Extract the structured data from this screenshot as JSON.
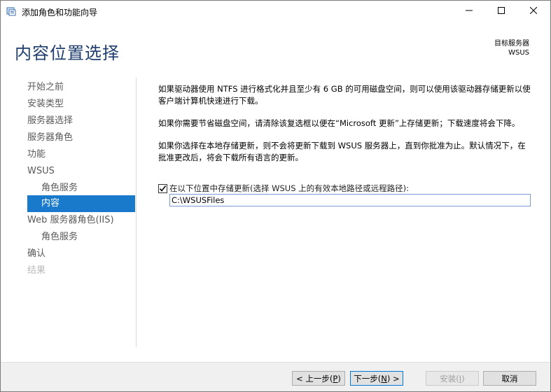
{
  "window": {
    "title": "添加角色和功能向导"
  },
  "header": {
    "page_title": "内容位置选择",
    "target_label": "目标服务器",
    "target_server": "WSUS"
  },
  "nav": {
    "items": [
      {
        "label": "开始之前"
      },
      {
        "label": "安装类型"
      },
      {
        "label": "服务器选择"
      },
      {
        "label": "服务器角色"
      },
      {
        "label": "功能"
      },
      {
        "label": "WSUS"
      },
      {
        "label": "角色服务"
      },
      {
        "label": "内容"
      },
      {
        "label": "Web 服务器角色(IIS)"
      },
      {
        "label": "角色服务"
      },
      {
        "label": "确认"
      },
      {
        "label": "结果"
      }
    ]
  },
  "content": {
    "para1": "如果驱动器使用 NTFS 进行格式化并且至少有 6 GB 的可用磁盘空间，则可以使用该驱动器存储更新以使客户端计算机快速进行下载。",
    "para2": "如果你需要节省磁盘空间，请清除该复选框以便在“Microsoft 更新”上存储更新；下载速度将会下降。",
    "para3": "如果你选择在本地存储更新，则不会将更新下载到 WSUS 服务器上，直到你批准为止。默认情况下，在批准更改后，将会下载所有语言的更新。",
    "checkbox_label": "在以下位置中存储更新(选择 WSUS 上的有效本地路径或远程路径):",
    "checkbox_checked": true,
    "path_value": "C:\\WSUSFiles"
  },
  "footer": {
    "prev": {
      "text": "< 上一步(",
      "key": "P",
      "tail": ")"
    },
    "next": {
      "text": "下一步(",
      "key": "N",
      "tail": ") >"
    },
    "install": {
      "text": "安装(",
      "key": "I",
      "tail": ")"
    },
    "cancel": "取消"
  },
  "colors": {
    "accent": "#1979ca",
    "title": "#1e3d6e"
  },
  "icons": {
    "app": "roles-wizard-icon",
    "minimize": "minimize-icon",
    "maximize": "maximize-icon",
    "close": "close-icon",
    "check": "checkmark-icon"
  }
}
